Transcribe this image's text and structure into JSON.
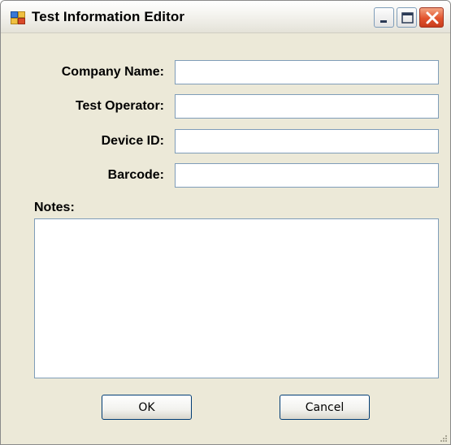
{
  "window": {
    "title": "Test Information Editor",
    "icon": "app-window-icon"
  },
  "title_controls": {
    "minimize_icon": "minimize-icon",
    "maximize_icon": "maximize-icon",
    "close_icon": "close-icon"
  },
  "form": {
    "company_name": {
      "label": "Company Name:",
      "value": ""
    },
    "test_operator": {
      "label": "Test Operator:",
      "value": ""
    },
    "device_id": {
      "label": "Device ID:",
      "value": ""
    },
    "barcode": {
      "label": "Barcode:",
      "value": ""
    },
    "notes": {
      "label": "Notes:",
      "value": ""
    }
  },
  "buttons": {
    "ok_label": "OK",
    "cancel_label": "Cancel"
  },
  "colors": {
    "window_background": "#ece9d8",
    "input_border": "#7f9db9",
    "close_button": "#e2532d",
    "button_border": "#003c74"
  }
}
